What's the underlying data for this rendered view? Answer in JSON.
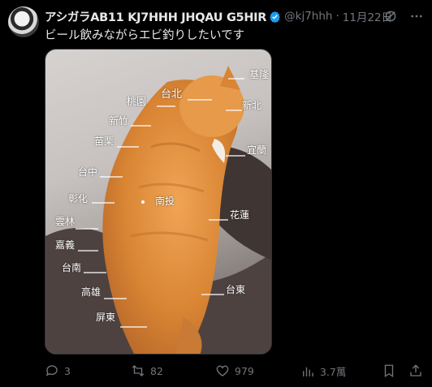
{
  "tweet": {
    "display_name": "アシガラAB11 KJ7HHH JHQAU G5HIR",
    "handle": "@kj7hhh",
    "separator": "·",
    "date": "11月22日",
    "text": "ビール飲みながらエビ釣りしたいです"
  },
  "image_labels": [
    {
      "id": "keelung",
      "text": "基隆"
    },
    {
      "id": "taipei",
      "text": "台北"
    },
    {
      "id": "taoyuan",
      "text": "桃園"
    },
    {
      "id": "newtaipei",
      "text": "新北"
    },
    {
      "id": "hsinchu",
      "text": "新竹"
    },
    {
      "id": "miaoli",
      "text": "苗栗"
    },
    {
      "id": "yilan",
      "text": "宜蘭"
    },
    {
      "id": "taichung",
      "text": "台中"
    },
    {
      "id": "changhua",
      "text": "彰化"
    },
    {
      "id": "nantou",
      "text": "南投"
    },
    {
      "id": "hualien",
      "text": "花蓮"
    },
    {
      "id": "yunlin",
      "text": "雲林"
    },
    {
      "id": "chiayi",
      "text": "嘉義"
    },
    {
      "id": "tainan",
      "text": "台南"
    },
    {
      "id": "kaohsiung",
      "text": "高雄"
    },
    {
      "id": "taitung",
      "text": "台東"
    },
    {
      "id": "pingtung",
      "text": "屏東"
    }
  ],
  "actions": {
    "replies": "3",
    "reposts": "82",
    "likes": "979",
    "views": "3.7萬"
  },
  "colors": {
    "background": "#000000",
    "text": "#e7e9ea",
    "muted": "#71767b",
    "verified": "#1d9bf0",
    "cat": "#e08a3c"
  }
}
